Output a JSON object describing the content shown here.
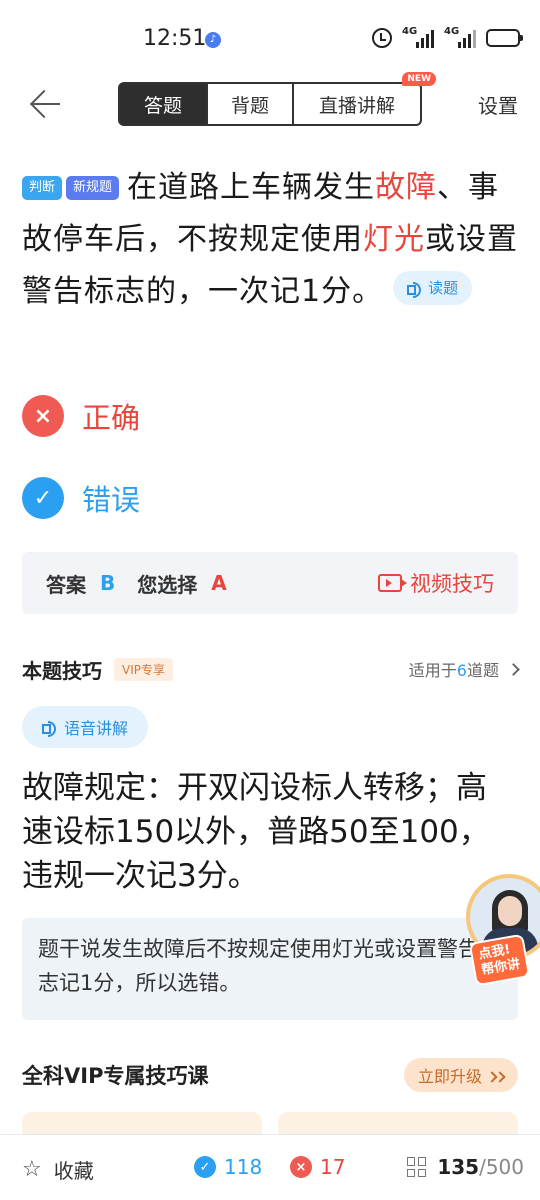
{
  "status_bar": {
    "time": "12:51",
    "signal1": "4G",
    "signal2": "4G"
  },
  "nav": {
    "tabs": [
      {
        "label": "答题",
        "active": true
      },
      {
        "label": "背题",
        "active": false
      },
      {
        "label": "直播讲解",
        "active": false
      }
    ],
    "new_badge": "NEW",
    "settings_label": "设置"
  },
  "question": {
    "tags": [
      "判断",
      "新规题"
    ],
    "text_part1": "在道路上车辆发生",
    "highlight1": "故障",
    "text_part2": "、事故停车后，不按规定使用",
    "highlight2": "灯光",
    "text_part3": "或设置警告标志的，一次记1分。",
    "read_label": "读题"
  },
  "options": [
    {
      "label": "正确",
      "state": "wrong",
      "mark": "×"
    },
    {
      "label": "错误",
      "state": "right",
      "mark": "✓"
    }
  ],
  "answer": {
    "answer_label": "答案",
    "answer_value": "B",
    "your_label": "您选择",
    "your_value": "A",
    "video_label": "视频技巧"
  },
  "tips": {
    "title": "本题技巧",
    "vip_tag": "VIP专享",
    "applies_prefix": "适用于",
    "applies_count": "6",
    "applies_suffix": "道题",
    "voice_label": "语音讲解",
    "tip_text": "故障规定：开双闪设标人转移；高速设标150以外，普路50至100，违规一次记3分。",
    "explanation": "题干说发生故障后不按规定使用灯光或设置警告标志记1分，所以选错。"
  },
  "helper": {
    "label_line1": "点我!",
    "label_line2": "帮你讲"
  },
  "vip_course": {
    "title": "全科VIP专属技巧课",
    "upgrade_label": "立即升级"
  },
  "bottom_bar": {
    "favorite_label": "收藏",
    "correct_count": "118",
    "wrong_count": "17",
    "progress_current": "135",
    "progress_total": "/500"
  },
  "colors": {
    "accent_blue": "#2b9ff0",
    "error_red": "#e8453c",
    "vip_orange": "#c56a2a"
  }
}
